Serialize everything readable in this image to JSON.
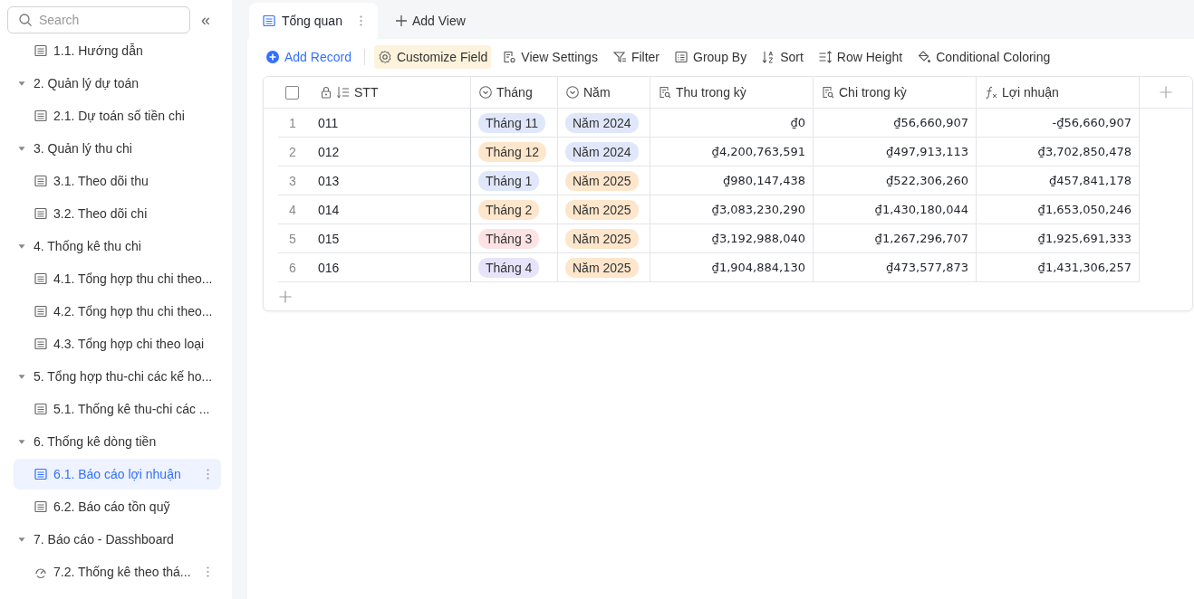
{
  "sidebar": {
    "search": {
      "placeholder": "Search"
    },
    "collapse_icon": "«",
    "items": [
      {
        "label": "1.1. Hướng dẫn",
        "kind": "table",
        "selected": false
      },
      {
        "label": "2. Quản lý dự toán",
        "kind": "group",
        "expanded": true,
        "children": [
          {
            "label": "2.1. Dự toán số tiền chi",
            "kind": "table",
            "selected": false
          }
        ]
      },
      {
        "label": "3. Quản lý thu chi",
        "kind": "group",
        "expanded": true,
        "children": [
          {
            "label": "3.1. Theo dõi thu",
            "kind": "table",
            "selected": false
          },
          {
            "label": "3.2. Theo dõi chi",
            "kind": "table",
            "selected": false
          }
        ]
      },
      {
        "label": "4. Thống kê thu chi",
        "kind": "group",
        "expanded": true,
        "children": [
          {
            "label": "4.1. Tổng hợp thu chi theo...",
            "kind": "table",
            "selected": false
          },
          {
            "label": "4.2. Tổng hợp thu chi theo...",
            "kind": "table",
            "selected": false
          },
          {
            "label": "4.3. Tổng hợp chi theo loại",
            "kind": "table",
            "selected": false
          }
        ]
      },
      {
        "label": "5. Tổng hợp thu-chi các kế ho...",
        "kind": "group",
        "expanded": true,
        "children": [
          {
            "label": "5.1. Thống kê thu-chi các ...",
            "kind": "table",
            "selected": false
          }
        ]
      },
      {
        "label": "6. Thống kê dòng tiền",
        "kind": "group",
        "expanded": true,
        "children": [
          {
            "label": "6.1. Báo cáo lợi nhuận",
            "kind": "table",
            "selected": true
          },
          {
            "label": "6.2. Báo cáo tồn quỹ",
            "kind": "table",
            "selected": false
          }
        ]
      },
      {
        "label": "7. Báo cáo - Dasshboard",
        "kind": "group",
        "expanded": true,
        "children": [
          {
            "label": "7.2. Thống kê theo thá...",
            "kind": "dashboard",
            "selected": false
          }
        ]
      }
    ]
  },
  "view_tabs": [
    {
      "label": "Tổng quan",
      "selected": true
    }
  ],
  "add_view": "Add View",
  "toolbar": [
    {
      "label": "Add Record",
      "kind": "add",
      "highlighted": false
    },
    {
      "label": "Customize Field",
      "kind": "gear",
      "highlighted": true
    },
    {
      "label": "View Settings",
      "kind": "settings",
      "highlighted": false
    },
    {
      "label": "Filter",
      "kind": "filter",
      "highlighted": false
    },
    {
      "label": "Group By",
      "kind": "group",
      "highlighted": false
    },
    {
      "label": "Sort",
      "kind": "sort",
      "highlighted": false
    },
    {
      "label": "Row Height",
      "kind": "height",
      "highlighted": false
    },
    {
      "label": "Conditional Coloring",
      "kind": "coloring",
      "highlighted": false
    }
  ],
  "table": {
    "select_all": {
      "checked": false
    },
    "columns": [
      {
        "label": "STT",
        "kind": "primary"
      },
      {
        "label": "Tháng",
        "kind": "select"
      },
      {
        "label": "Năm",
        "kind": "select"
      },
      {
        "label": "Thu trong kỳ",
        "kind": "lookup"
      },
      {
        "label": "Chi trong kỳ",
        "kind": "lookup"
      },
      {
        "label": "Lợi nhuận",
        "kind": "formula"
      }
    ],
    "rows": [
      {
        "index": "1",
        "stt": "011",
        "month": {
          "text": "Tháng 11",
          "color": "#e0e7fb"
        },
        "year": {
          "text": "Năm 2024",
          "color": "#e0e7fb"
        },
        "thu": "₫0",
        "chi": "₫56,660,907",
        "loi": "-₫56,660,907"
      },
      {
        "index": "2",
        "stt": "012",
        "month": {
          "text": "Tháng 12",
          "color": "#fde6cb"
        },
        "year": {
          "text": "Năm 2024",
          "color": "#e0e7fb"
        },
        "thu": "₫4,200,763,591",
        "chi": "₫497,913,113",
        "loi": "₫3,702,850,478"
      },
      {
        "index": "3",
        "stt": "013",
        "month": {
          "text": "Tháng 1",
          "color": "#e0e7fb"
        },
        "year": {
          "text": "Năm 2025",
          "color": "#fde6cb"
        },
        "thu": "₫980,147,438",
        "chi": "₫522,306,260",
        "loi": "₫457,841,178"
      },
      {
        "index": "4",
        "stt": "014",
        "month": {
          "text": "Tháng 2",
          "color": "#fde6cb"
        },
        "year": {
          "text": "Năm 2025",
          "color": "#fde6cb"
        },
        "thu": "₫3,083,230,290",
        "chi": "₫1,430,180,044",
        "loi": "₫1,653,050,246"
      },
      {
        "index": "5",
        "stt": "015",
        "month": {
          "text": "Tháng 3",
          "color": "#fde2e4"
        },
        "year": {
          "text": "Năm 2025",
          "color": "#fde6cb"
        },
        "thu": "₫3,192,988,040",
        "chi": "₫1,267,296,707",
        "loi": "₫1,925,691,333"
      },
      {
        "index": "6",
        "stt": "016",
        "month": {
          "text": "Tháng 4",
          "color": "#e7e3fb"
        },
        "year": {
          "text": "Năm 2025",
          "color": "#fde6cb"
        },
        "thu": "₫1,904,884,130",
        "chi": "₫473,577,873",
        "loi": "₫1,431,306,257"
      }
    ]
  }
}
